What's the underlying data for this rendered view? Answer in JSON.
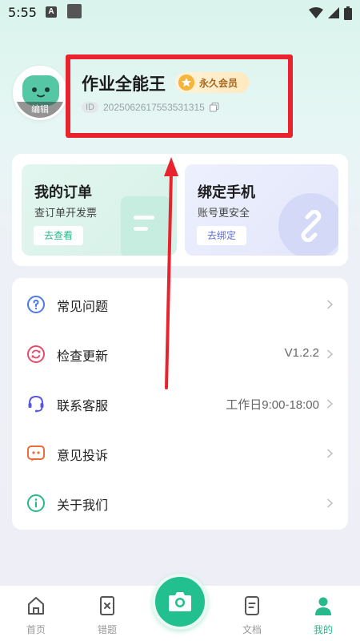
{
  "status_bar": {
    "time": "5:55",
    "notification_badge": "A"
  },
  "profile": {
    "username": "作业全能王",
    "vip_label": "永久会员",
    "id_tag": "ID",
    "id_value": "2025062617553531315",
    "avatar_edit_label": "编辑"
  },
  "cards": {
    "orders": {
      "title": "我的订单",
      "subtitle": "查订单开发票",
      "button": "去查看"
    },
    "phone": {
      "title": "绑定手机",
      "subtitle": "账号更安全",
      "button": "去绑定"
    }
  },
  "menu": {
    "items": [
      {
        "label": "常见问题",
        "value": "",
        "icon": "help-icon",
        "color": "#4b7be8"
      },
      {
        "label": "检查更新",
        "value": "V1.2.2",
        "icon": "refresh-icon",
        "color": "#e84a6a"
      },
      {
        "label": "联系客服",
        "value": "工作日9:00-18:00",
        "icon": "headset-icon",
        "color": "#5a55e0"
      },
      {
        "label": "意见投诉",
        "value": "",
        "icon": "chat-icon",
        "color": "#f06a3a"
      },
      {
        "label": "关于我们",
        "value": "",
        "icon": "info-icon",
        "color": "#27b98b"
      }
    ]
  },
  "bottom_nav": {
    "items": [
      {
        "label": "首页",
        "icon": "home-icon"
      },
      {
        "label": "错题",
        "icon": "wrong-questions-icon"
      },
      {
        "label": "文档",
        "icon": "document-icon"
      },
      {
        "label": "我的",
        "icon": "profile-icon",
        "active": true
      }
    ],
    "camera_icon": "camera-icon"
  },
  "colors": {
    "accent": "#27b98b",
    "highlight": "#e8232e",
    "vip_gold": "#f5b43b"
  }
}
